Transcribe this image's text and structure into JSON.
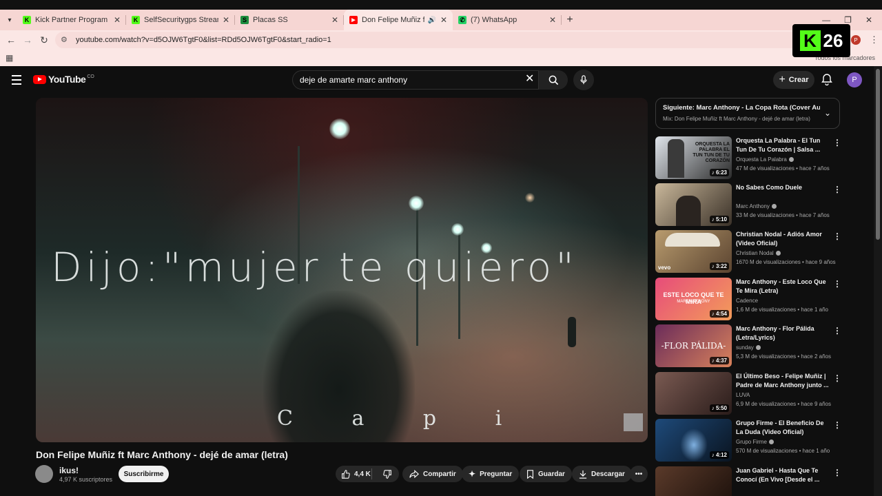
{
  "browser": {
    "tabs": [
      {
        "title": "Kick Partner Program - Kick Dash",
        "favicon_color": "#53fc18",
        "favicon_glyph": "K"
      },
      {
        "title": "SelfSecuritygps Stream - Watch",
        "favicon_color": "#53fc18",
        "favicon_glyph": "K"
      },
      {
        "title": "Placas SS",
        "favicon_color": "#1e8e3e",
        "favicon_glyph": "S"
      },
      {
        "title": "Don Felipe Muñiz ft Marc Anthony",
        "favicon_color": "#ff0000",
        "favicon_glyph": "▶",
        "active": true
      },
      {
        "title": "(7) WhatsApp",
        "favicon_color": "#25d366",
        "favicon_glyph": "✆"
      }
    ],
    "url": "youtube.com/watch?v=d5OJW6TgtF0&list=RDd5OJW6TgtF0&start_radio=1",
    "all_bookmarks": "Todos los marcadores",
    "profile_initial": "P"
  },
  "overlay": {
    "badge_letter": "K",
    "badge_number": "26"
  },
  "youtube": {
    "logo_text": "YouTube",
    "country_code": "CO",
    "search_value": "deje de amarte marc anthony",
    "create_label": "Crear",
    "avatar_initial": "P"
  },
  "video": {
    "lyric_main": "Dijo:\"mujer te quiero\"",
    "lyric_bottom": "C a p i",
    "title": "Don Felipe Muñiz ft Marc Anthony - dejé de amar (letra)",
    "channel": "ikus!",
    "subscribers": "4,97 K suscriptores",
    "subscribe_label": "Suscribirme",
    "likes": "4,4 K",
    "share_label": "Compartir",
    "ask_label": "Preguntar",
    "save_label": "Guardar",
    "download_label": "Descargar"
  },
  "upnext": {
    "line1": "Siguiente: Marc Anthony - La Copa Rota (Cover Audio)",
    "line2": "Mix: Don Felipe Muñiz ft Marc Anthony - dejé de amar (letra)"
  },
  "recommendations": [
    {
      "title": "Orquesta La Palabra - El Tun Tun De Tu Corazón | Salsa ...",
      "channel": "Orquesta La Palabra",
      "meta": "47 M de visualizaciones • hace 7 años",
      "duration": "6:23",
      "verified": true,
      "thumb_colors": [
        "#dfe4ea",
        "#2b2b2b"
      ]
    },
    {
      "title": "No Sabes Como Duele",
      "channel": "Marc Anthony",
      "meta": "33 M de visualizaciones • hace 7 años",
      "duration": "5:10",
      "verified": true,
      "thumb_colors": [
        "#c9b79a",
        "#3a3128"
      ]
    },
    {
      "title": "Christian Nodal - Adiós Amor (Video Oficial)",
      "channel": "Christian Nodal",
      "meta": "1670 M de visualizaciones • hace 9 años",
      "duration": "3:22",
      "verified": true,
      "thumb_colors": [
        "#b89b6e",
        "#5b4430"
      ]
    },
    {
      "title": "Marc Anthony - Este Loco Que Te Mira (Letra)",
      "channel": "Cadence",
      "meta": "1,6 M de visualizaciones • hace 1 año",
      "duration": "4:54",
      "verified": false,
      "thumb_colors": [
        "#e74c7a",
        "#f39c5a"
      ]
    },
    {
      "title": "Marc Anthony - Flor Pálida (Letra/Lyrics)",
      "channel": "sunday",
      "meta": "5,3 M de visualizaciones • hace 2 años",
      "duration": "4:37",
      "verified": true,
      "thumb_colors": [
        "#6b2c5a",
        "#d9825b"
      ]
    },
    {
      "title": "El Último Beso - Felipe Muñiz | Padre de Marc Anthony junto ...",
      "channel": "LUVA",
      "meta": "6,9 M de visualizaciones • hace 9 años",
      "duration": "5:50",
      "verified": false,
      "thumb_colors": [
        "#7a5a52",
        "#2a1c1a"
      ]
    },
    {
      "title": "Grupo Firme - El Beneficio De La Duda (Video Oficial)",
      "channel": "Grupo Firme",
      "meta": "570 M de visualizaciones • hace 1 año",
      "duration": "4:12",
      "verified": true,
      "thumb_colors": [
        "#1e4a7a",
        "#0a1420"
      ]
    },
    {
      "title": "Juan Gabriel - Hasta Que Te Conocí (En Vivo [Desde el ...",
      "channel": "",
      "meta": "",
      "duration": "",
      "verified": false,
      "thumb_colors": [
        "#5a3a2a",
        "#1a0f0a"
      ]
    }
  ],
  "thumb_texts": {
    "t0": "ORQUESTA LA PALABRA EL TUN TUN DE TU CORAZÓN",
    "t3": "ESTE LOCO QUE TE MIRA",
    "t3b": "MARC ANTHONY",
    "t4": "-FLOR PÁLIDA-",
    "t2": "vevo"
  }
}
